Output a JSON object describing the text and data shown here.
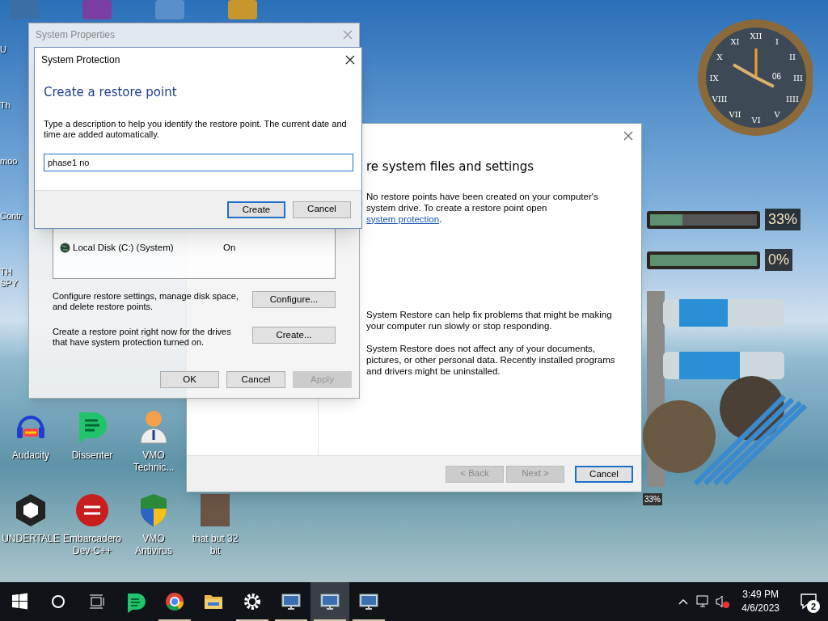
{
  "desktop_left_labels": [
    {
      "label": "U"
    },
    {
      "label": "Th"
    },
    {
      "label": "moo"
    },
    {
      "label": "Contr"
    },
    {
      "label": "TH SPY"
    }
  ],
  "desktop_icons": [
    {
      "kind": "audacity",
      "label": "Audacity"
    },
    {
      "kind": "dissenter",
      "label": "Dissenter"
    },
    {
      "kind": "doctor",
      "label": "VMO Technic..."
    },
    {
      "kind": "unity",
      "label": "UNDERTALE"
    },
    {
      "kind": "devcpp",
      "label": "Embarcadero Dev-C++"
    },
    {
      "kind": "shield",
      "label": "VMO Antivirus"
    },
    {
      "kind": "photo",
      "label": "that but 32 bit"
    }
  ],
  "system_properties": {
    "title": "System Properties",
    "drives": [
      {
        "name": "Local Disk (C:) (System)",
        "protection": "On"
      }
    ],
    "configure_text": "Configure restore settings, manage disk space, and delete restore points.",
    "configure_button": "Configure...",
    "create_text": "Create a restore point right now for the drives that have system protection turned on.",
    "create_button": "Create...",
    "buttons": [
      {
        "label": "OK",
        "disabled": false
      },
      {
        "label": "Cancel",
        "disabled": false
      },
      {
        "label": "Apply",
        "disabled": true
      }
    ]
  },
  "system_protection": {
    "title": "System Protection",
    "heading": "Create a restore point",
    "description": "Type a description to help you identify the restore point. The current date and time are added automatically.",
    "input_value": "phase1 no ",
    "buttons": [
      {
        "label": "Create",
        "default": true
      },
      {
        "label": "Cancel",
        "default": false
      }
    ]
  },
  "wizard": {
    "title": "re system files and settings",
    "message": {
      "before": "No restore points have been created on your computer's system drive. To create a restore point open ",
      "link": "system protection",
      "after": "."
    },
    "paragraphs": [
      "System Restore can help fix problems that might be making your computer run slowly or stop responding.",
      "System Restore does not affect any of your documents, pictures, or other personal data. Recently installed programs and drivers might be uninstalled."
    ],
    "buttons": [
      {
        "label": "< Back",
        "disabled": true,
        "default": false
      },
      {
        "label": "Next >",
        "disabled": true,
        "default": false
      },
      {
        "label": "Cancel",
        "disabled": false,
        "default": true
      }
    ]
  },
  "gadget": {
    "clock": {
      "numerals": [
        "XII",
        "XI",
        "I",
        "X",
        "II",
        "IX",
        "III",
        "VIII",
        "IIII",
        "VII",
        "V",
        "VI"
      ],
      "date": "06"
    },
    "drives": [
      {
        "level": 0.3,
        "reading": "33%"
      },
      {
        "level": 1,
        "reading": "0%"
      }
    ],
    "gauge_reading": "33%"
  },
  "taskbar": {
    "apps": [
      {
        "kind": "dissenter",
        "running": false,
        "active": false
      },
      {
        "kind": "chrome",
        "running": true,
        "active": false
      },
      {
        "kind": "folder",
        "running": false,
        "active": false
      },
      {
        "kind": "gear",
        "running": true,
        "active": false
      },
      {
        "kind": "monitor",
        "running": true,
        "active": false
      },
      {
        "kind": "monitor",
        "running": true,
        "active": true
      },
      {
        "kind": "monitor",
        "running": true,
        "active": false
      }
    ],
    "time": "3:49 PM",
    "date": "4/6/2023",
    "notifications": "2"
  }
}
